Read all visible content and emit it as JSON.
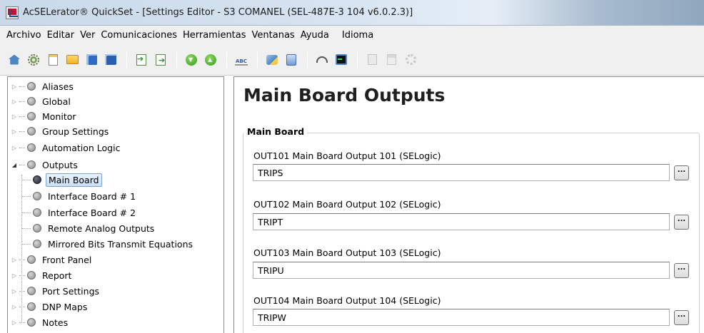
{
  "window": {
    "title": "AcSELerator® QuickSet - [Settings Editor - S3 COMANEL (SEL-487E-3 104 v6.0.2.3)]"
  },
  "menubar": {
    "items": [
      "Archivo",
      "Editar",
      "Ver",
      "Comunicaciones",
      "Herramientas",
      "Ventanas",
      "Ayuda",
      "Idioma"
    ]
  },
  "toolbar": {
    "icons": [
      "home-icon",
      "settings-gears-icon",
      "new-document-icon",
      "open-folder-icon",
      "save-icon",
      "save-all-icon",
      "import-icon",
      "export-icon",
      "read-icon",
      "send-icon",
      "spell-check-icon",
      "wand-icon",
      "clipboard-icon",
      "meter-gauge-icon",
      "terminal-icon",
      "disabled-doc-icon",
      "disabled-list-icon",
      "disabled-gear-icon"
    ]
  },
  "tree": {
    "items": [
      {
        "label": "Aliases"
      },
      {
        "label": "Global"
      },
      {
        "label": "Monitor"
      },
      {
        "label": "Group Settings"
      },
      {
        "label": "Automation Logic"
      },
      {
        "label": "Outputs"
      },
      {
        "label": "Main Board"
      },
      {
        "label": "Interface Board # 1"
      },
      {
        "label": "Interface Board # 2"
      },
      {
        "label": "Remote Analog Outputs"
      },
      {
        "label": "Mirrored Bits Transmit Equations"
      },
      {
        "label": "Front Panel"
      },
      {
        "label": "Report"
      },
      {
        "label": "Port Settings"
      },
      {
        "label": "DNP Maps"
      },
      {
        "label": "Notes"
      }
    ]
  },
  "main": {
    "title": "Main Board Outputs",
    "group_label": "Main Board",
    "fields": [
      {
        "label": "OUT101  Main Board Output 101 (SELogic)",
        "value": "TRIPS",
        "button": "..."
      },
      {
        "label": "OUT102  Main Board Output 102 (SELogic)",
        "value": "TRIPT",
        "button": "..."
      },
      {
        "label": "OUT103  Main Board Output 103 (SELogic)",
        "value": "TRIPU",
        "button": "..."
      },
      {
        "label": "OUT104  Main Board Output 104 (SELogic)",
        "value": "TRIPW",
        "button": "..."
      }
    ]
  }
}
